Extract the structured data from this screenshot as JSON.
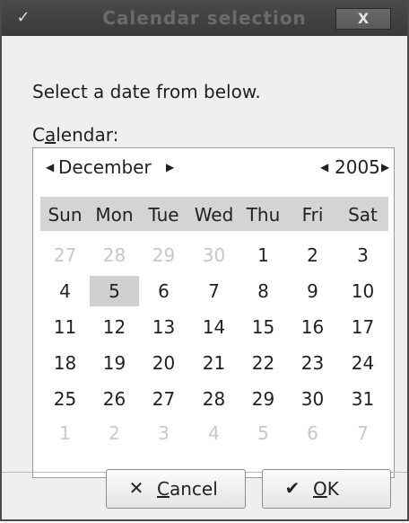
{
  "window": {
    "title": "Calendar selection",
    "menu_icon": "chevron-down-icon",
    "close_glyph": "X"
  },
  "instruction": "Select a date from below.",
  "calendar_label": {
    "prefix": "C",
    "mnemonic": "a",
    "suffix": "lendar:"
  },
  "calendar": {
    "month": "December",
    "year": "2005",
    "weekdays": [
      "Sun",
      "Mon",
      "Tue",
      "Wed",
      "Thu",
      "Fri",
      "Sat"
    ],
    "selected_day": "5",
    "weeks": [
      [
        "27",
        "28",
        "29",
        "30",
        "1",
        "2",
        "3"
      ],
      [
        "4",
        "5",
        "6",
        "7",
        "8",
        "9",
        "10"
      ],
      [
        "11",
        "12",
        "13",
        "14",
        "15",
        "16",
        "17"
      ],
      [
        "18",
        "19",
        "20",
        "21",
        "22",
        "23",
        "24"
      ],
      [
        "25",
        "26",
        "27",
        "28",
        "29",
        "30",
        "31"
      ],
      [
        "1",
        "2",
        "3",
        "4",
        "5",
        "6",
        "7"
      ]
    ]
  },
  "buttons": {
    "cancel": {
      "icon": "cancel-x-icon",
      "mnemonic": "C",
      "suffix": "ancel"
    },
    "ok": {
      "icon": "checkmark-icon",
      "mnemonic": "O",
      "suffix": "K"
    }
  }
}
